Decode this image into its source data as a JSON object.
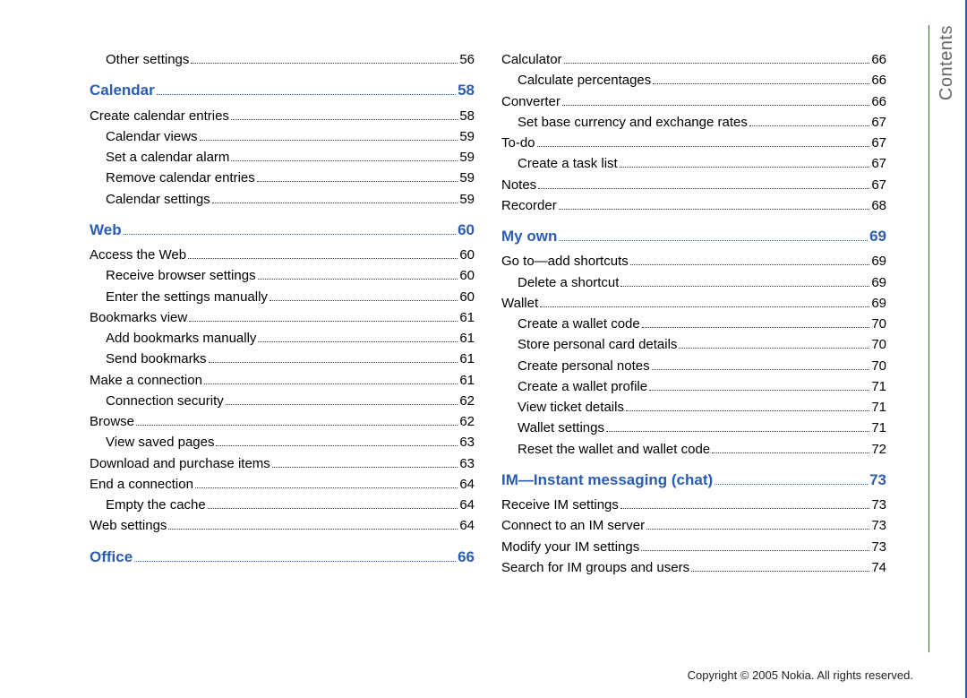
{
  "side_tab": "Contents",
  "footer": "Copyright © 2005 Nokia. All rights reserved.",
  "columns": [
    [
      {
        "type": "l2",
        "label": "Other settings",
        "page": "56"
      },
      {
        "type": "chapter",
        "label": "Calendar",
        "page": "58"
      },
      {
        "type": "l1",
        "label": "Create calendar entries",
        "page": "58"
      },
      {
        "type": "l2",
        "label": "Calendar views",
        "page": "59"
      },
      {
        "type": "l2",
        "label": "Set a calendar alarm",
        "page": "59"
      },
      {
        "type": "l2",
        "label": "Remove calendar entries",
        "page": "59"
      },
      {
        "type": "l2",
        "label": "Calendar settings",
        "page": "59"
      },
      {
        "type": "chapter",
        "label": "Web",
        "page": "60"
      },
      {
        "type": "l1",
        "label": "Access the Web",
        "page": "60"
      },
      {
        "type": "l2",
        "label": "Receive browser settings",
        "page": "60"
      },
      {
        "type": "l2",
        "label": "Enter the settings manually",
        "page": "60"
      },
      {
        "type": "l1",
        "label": "Bookmarks view",
        "page": "61"
      },
      {
        "type": "l2",
        "label": "Add bookmarks manually",
        "page": "61"
      },
      {
        "type": "l2",
        "label": "Send bookmarks",
        "page": "61"
      },
      {
        "type": "l1",
        "label": "Make a connection",
        "page": "61"
      },
      {
        "type": "l2",
        "label": "Connection security",
        "page": "62"
      },
      {
        "type": "l1",
        "label": "Browse",
        "page": "62"
      },
      {
        "type": "l2",
        "label": "View saved pages",
        "page": "63"
      },
      {
        "type": "l1",
        "label": "Download and purchase items",
        "page": "63"
      },
      {
        "type": "l1",
        "label": "End a connection",
        "page": "64"
      },
      {
        "type": "l2",
        "label": "Empty the cache",
        "page": "64"
      },
      {
        "type": "l1",
        "label": "Web settings",
        "page": "64"
      },
      {
        "type": "chapter",
        "label": "Office",
        "page": "66"
      }
    ],
    [
      {
        "type": "l1",
        "label": "Calculator",
        "page": "66"
      },
      {
        "type": "l2",
        "label": "Calculate percentages",
        "page": "66"
      },
      {
        "type": "l1",
        "label": "Converter",
        "page": "66"
      },
      {
        "type": "l2",
        "label": "Set base currency and exchange rates",
        "page": "67"
      },
      {
        "type": "l1",
        "label": "To-do",
        "page": "67"
      },
      {
        "type": "l2",
        "label": "Create a task list",
        "page": "67"
      },
      {
        "type": "l1",
        "label": "Notes",
        "page": "67"
      },
      {
        "type": "l1",
        "label": "Recorder",
        "page": "68"
      },
      {
        "type": "chapter",
        "label": "My own",
        "page": "69"
      },
      {
        "type": "l1",
        "label": "Go to—add shortcuts",
        "page": "69"
      },
      {
        "type": "l2",
        "label": "Delete a shortcut",
        "page": "69"
      },
      {
        "type": "l1",
        "label": "Wallet",
        "page": "69"
      },
      {
        "type": "l2",
        "label": "Create a wallet code",
        "page": "70"
      },
      {
        "type": "l2",
        "label": "Store personal card details",
        "page": "70"
      },
      {
        "type": "l2",
        "label": "Create personal notes",
        "page": "70"
      },
      {
        "type": "l2",
        "label": "Create a wallet profile",
        "page": "71"
      },
      {
        "type": "l2",
        "label": "View ticket details",
        "page": "71"
      },
      {
        "type": "l2",
        "label": "Wallet settings",
        "page": "71"
      },
      {
        "type": "l2",
        "label": "Reset the wallet and wallet code",
        "page": "72"
      },
      {
        "type": "chapter",
        "label": "IM—Instant messaging (chat)",
        "page": "73"
      },
      {
        "type": "l1",
        "label": "Receive IM settings",
        "page": "73"
      },
      {
        "type": "l1",
        "label": "Connect to an IM server",
        "page": "73"
      },
      {
        "type": "l1",
        "label": "Modify your IM settings",
        "page": "73"
      },
      {
        "type": "l1",
        "label": "Search for IM groups and users",
        "page": "74"
      }
    ]
  ]
}
